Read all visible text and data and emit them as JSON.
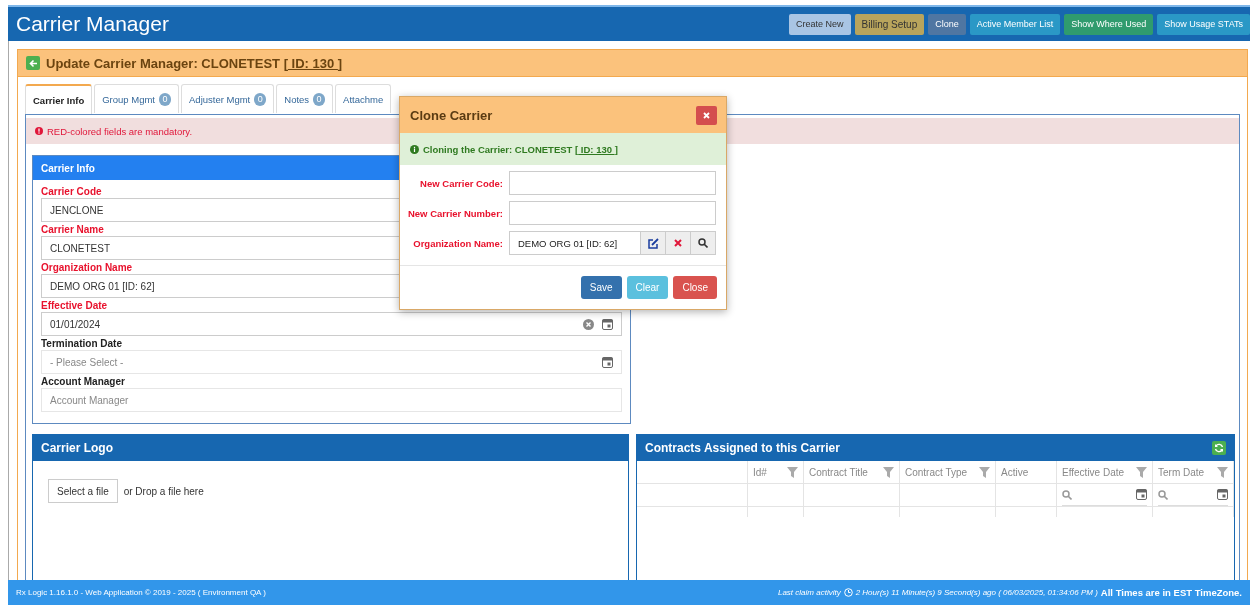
{
  "app_header": {
    "title": "Carrier Manager",
    "buttons": [
      {
        "label": "Create New",
        "kind": "light"
      },
      {
        "label": "Billing Setup",
        "kind": "olive"
      },
      {
        "label": "Clone",
        "kind": "slate"
      },
      {
        "label": "Active Member List",
        "kind": "teal"
      },
      {
        "label": "Show Where Used",
        "kind": "green"
      },
      {
        "label": "Show Usage STATs",
        "kind": "teal"
      }
    ]
  },
  "page_header": {
    "title": "Update Carrier Manager: CLONETEST [",
    "id_link": " ID: 130 ",
    "title_end": "]"
  },
  "tabs": [
    {
      "label": "Carrier Info",
      "selected": true
    },
    {
      "label": "Group Mgmt",
      "count": "0",
      "selected": false
    },
    {
      "label": "Adjuster Mgmt",
      "count": "0",
      "selected": false
    },
    {
      "label": "Notes",
      "count": "0",
      "selected": false
    },
    {
      "label": "Attachme",
      "selected": false
    }
  ],
  "alert": "RED-colored fields are mandatory.",
  "carrier_info": {
    "title": "Carrier Info",
    "fields": [
      {
        "label": "Carrier Code",
        "kind": "text",
        "required": true,
        "value": "JENCLONE"
      },
      {
        "label": "Carrier Name",
        "kind": "text",
        "required": true,
        "value": "CLONETEST"
      },
      {
        "label": "Organization Name",
        "kind": "text",
        "required": true,
        "value": "DEMO ORG 01 [ID: 62]"
      },
      {
        "label": "Effective Date",
        "kind": "date",
        "required": true,
        "clearable": true,
        "value": "01/01/2024"
      },
      {
        "label": "Termination Date",
        "kind": "date",
        "required": false,
        "placeholder": "- Please Select -"
      },
      {
        "label": "Account Manager",
        "kind": "text",
        "required": false,
        "placeholder": "Account Manager"
      }
    ]
  },
  "carrier_logo": {
    "title": "Carrier Logo",
    "select_button": "Select a file",
    "drop_text": "or Drop a file here"
  },
  "contracts": {
    "title": "Contracts Assigned to this Carrier",
    "columns": [
      {
        "filter": false,
        "search": false
      },
      {
        "label": "Id#",
        "filter": true,
        "search": false
      },
      {
        "label": "Contract Title",
        "filter": true,
        "search": false
      },
      {
        "label": "Contract Type",
        "filter": true,
        "search": false
      },
      {
        "label": "Active",
        "filter": false,
        "search": false
      },
      {
        "label": "Effective Date",
        "filter": true,
        "search": true
      },
      {
        "label": "Term Date",
        "filter": true,
        "search": true
      }
    ]
  },
  "modal": {
    "title": "Clone Carrier",
    "info": "Cloning the Carrier: CLONETEST [",
    "info_link": " ID: 130 ",
    "info_end": "]",
    "fields": [
      {
        "label": "New Carrier Code:",
        "kind": "text"
      },
      {
        "label": "New Carrier Number:",
        "kind": "text"
      },
      {
        "label": "Organization Name:",
        "kind": "lookup",
        "value": "DEMO ORG 01 [ID: 62]"
      }
    ],
    "buttons": [
      {
        "label": "Save",
        "kind": "primary"
      },
      {
        "label": "Clear",
        "kind": "info"
      },
      {
        "label": "Close",
        "kind": "danger"
      }
    ]
  },
  "footer": {
    "left": "Rx Logic 1.16.1.0 - Web Application © 2019 - 2025 ( Environment QA )",
    "activity": "Last claim activity",
    "ago": "2 Hour(s) 11 Minute(s) 9 Second(s) ago  ( 06/03/2025, 01:34:06 PM )",
    "timezone": "All Times are in EST TimeZone."
  }
}
